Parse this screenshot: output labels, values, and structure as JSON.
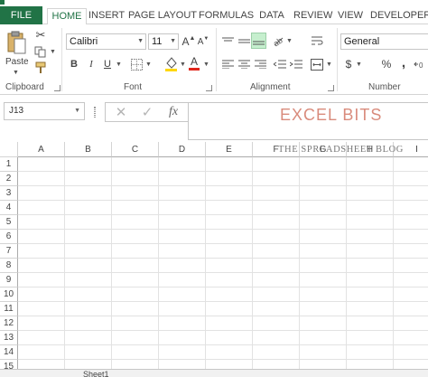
{
  "tabs": {
    "file": "FILE",
    "home": "HOME",
    "insert": "INSERT",
    "page_layout": "PAGE LAYOUT",
    "formulas": "FORMULAS",
    "data": "DATA",
    "review": "REVIEW",
    "view": "VIEW",
    "developer": "DEVELOPER"
  },
  "ribbon": {
    "clipboard": {
      "paste_label": "Paste",
      "group_label": "Clipboard"
    },
    "font": {
      "name": "Calibri",
      "size": "11",
      "group_label": "Font",
      "bold": "B",
      "italic": "I",
      "underline": "U"
    },
    "alignment": {
      "group_label": "Alignment"
    },
    "number": {
      "format": "General",
      "group_label": "Number",
      "currency": "$",
      "percent": "%",
      "comma": ","
    }
  },
  "formula_bar": {
    "name_box": "J13",
    "cancel_symbol": "✕",
    "enter_symbol": "✓",
    "fx_symbol": "fx",
    "brand_title": "EXCEL BITS",
    "brand_subtitle": "THE SPREADSHEET BLOG"
  },
  "grid": {
    "columns": [
      "A",
      "B",
      "C",
      "D",
      "E",
      "F",
      "G",
      "H",
      "I"
    ],
    "rows": [
      "1",
      "2",
      "3",
      "4",
      "5",
      "6",
      "7",
      "8",
      "9",
      "10",
      "11",
      "12",
      "13",
      "14",
      "15"
    ]
  },
  "sheet_tabs": [
    "Sheet1"
  ],
  "colors": {
    "accent": "#217346",
    "brand": "#d98b7c"
  }
}
